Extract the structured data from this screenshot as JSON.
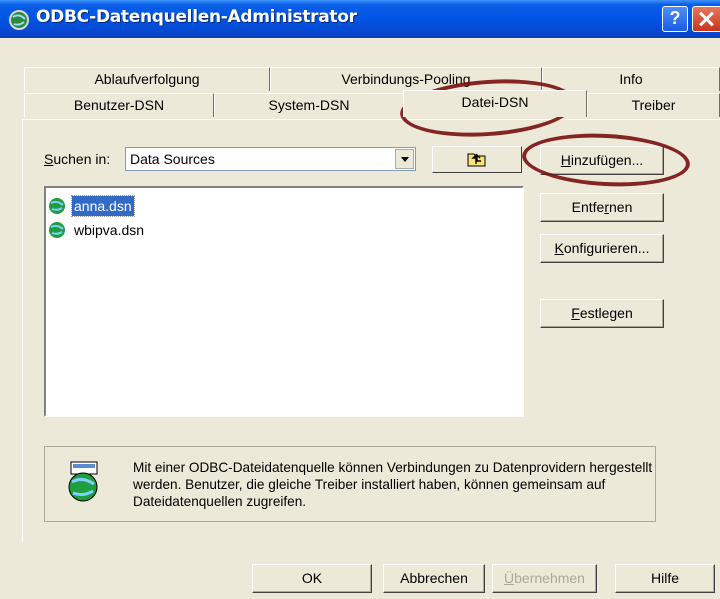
{
  "window": {
    "title": "ODBC-Datenquellen-Administrator",
    "help_glyph": "?"
  },
  "tabs_back": [
    "Ablaufverfolgung",
    "Verbindungs-Pooling",
    "Info"
  ],
  "tabs_front": [
    "Benutzer-DSN",
    "System-DSN",
    "Datei-DSN",
    "Treiber"
  ],
  "active_tab": "Datei-DSN",
  "search": {
    "label_prefix": "S",
    "label_rest": "uchen in:",
    "value": "Data Sources"
  },
  "files": [
    {
      "name": "anna.dsn",
      "selected": true
    },
    {
      "name": "wbipva.dsn",
      "selected": false
    }
  ],
  "side_buttons": {
    "add_u": "H",
    "add_rest": "inzufügen...",
    "remove_pre": "Entfe",
    "remove_u": "r",
    "remove_rest": "nen",
    "configure_u": "K",
    "configure_rest": "onfigurieren...",
    "set_u": "F",
    "set_rest": "estlegen"
  },
  "info_text": "Mit einer ODBC-Dateidatenquelle können Verbindungen zu Datenprovidern hergestellt werden. Benutzer, die gleiche Treiber installiert haben, können gemeinsam auf Dateidatenquellen zugreifen.",
  "bottom_buttons": {
    "ok": "OK",
    "cancel": "Abbrechen",
    "apply_u": "Ü",
    "apply_rest": "bernehmen",
    "help": "Hilfe"
  },
  "colors": {
    "titlebar": "#0054e3",
    "selection": "#316ac5",
    "annotation": "#7a0f0f"
  }
}
